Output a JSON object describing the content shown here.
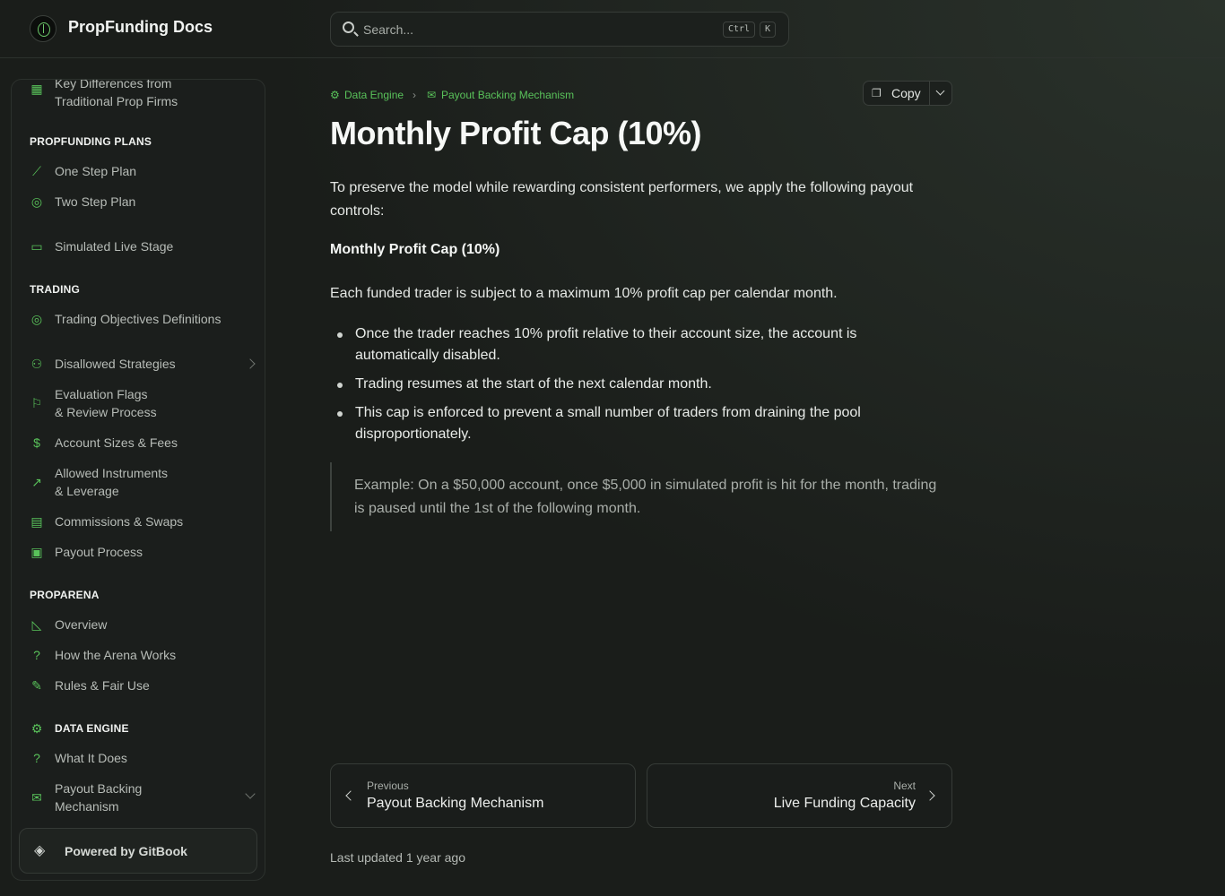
{
  "header": {
    "site_title": "PropFunding Docs",
    "search_placeholder": "Search...",
    "shortcut_keys": [
      "Ctrl",
      "K"
    ]
  },
  "sidebar": {
    "top_item": {
      "label": "Key Differences from\nTraditional Prop Firms",
      "icon": "table-icon"
    },
    "sections": [
      {
        "title": "PROPFUNDING PLANS",
        "items": [
          {
            "label": "One Step Plan",
            "icon": "stairs-icon"
          },
          {
            "label": "Two Step Plan",
            "icon": "target-icon"
          },
          {
            "label": "Simulated Live Stage",
            "icon": "monitor-icon"
          }
        ]
      },
      {
        "title": "TRADING",
        "items": [
          {
            "label": "Trading Objectives Definitions",
            "icon": "target-icon"
          },
          {
            "label": "Disallowed Strategies",
            "icon": "network-icon"
          },
          {
            "label": "Evaluation Flags\n& Review Process",
            "icon": "flag-icon"
          },
          {
            "label": "Account Sizes & Fees",
            "icon": "dollar-icon"
          },
          {
            "label": "Allowed Instruments\n& Leverage",
            "icon": "trend-icon"
          },
          {
            "label": "Commissions & Swaps",
            "icon": "receipt-icon"
          },
          {
            "label": "Payout Process",
            "icon": "safe-icon"
          }
        ]
      },
      {
        "title": "PROPARENA",
        "items": [
          {
            "label": "Overview",
            "icon": "area-chart-icon"
          },
          {
            "label": "How the Arena Works",
            "icon": "question-icon"
          },
          {
            "label": "Rules & Fair Use",
            "icon": "ruler-icon"
          }
        ]
      },
      {
        "title": "DATA ENGINE",
        "items": [
          {
            "label": "What It Does",
            "icon": "question-icon"
          },
          {
            "label": "Payout Backing\nMechanism",
            "icon": "mail-open-icon"
          }
        ]
      }
    ],
    "powered_by": "Powered by GitBook"
  },
  "breadcrumb": [
    {
      "label": "Data Engine",
      "icon": "engine-icon"
    },
    {
      "label": "Payout Backing Mechanism",
      "icon": "mail-open-icon"
    }
  ],
  "toolbar": {
    "copy_label": "Copy"
  },
  "page": {
    "title": "Monthly Profit Cap (10%)",
    "intro": "To preserve the model while rewarding consistent performers, we apply the following payout controls:",
    "subheading": "Monthly Profit Cap (10%)",
    "paragraph": "Each funded trader is subject to a maximum 10% profit cap per calendar month.",
    "bullets": [
      "Once the trader reaches 10% profit relative to their account size, the account is automatically disabled.",
      "Trading resumes at the start of the next calendar month.",
      "This cap is enforced to prevent a small number of traders from draining the pool disproportionately."
    ],
    "quote": "Example: On a $50,000 account, once $5,000 in simulated profit is hit for the month, trading is paused until the 1st of the following month."
  },
  "pagination": {
    "previous_label": "Previous",
    "previous_title": "Payout Backing Mechanism",
    "next_label": "Next",
    "next_title": "Live Funding Capacity"
  },
  "last_updated": "Last updated 1 year ago",
  "colors": {
    "accent": "#59c25a",
    "background": "#1a1d1a"
  }
}
